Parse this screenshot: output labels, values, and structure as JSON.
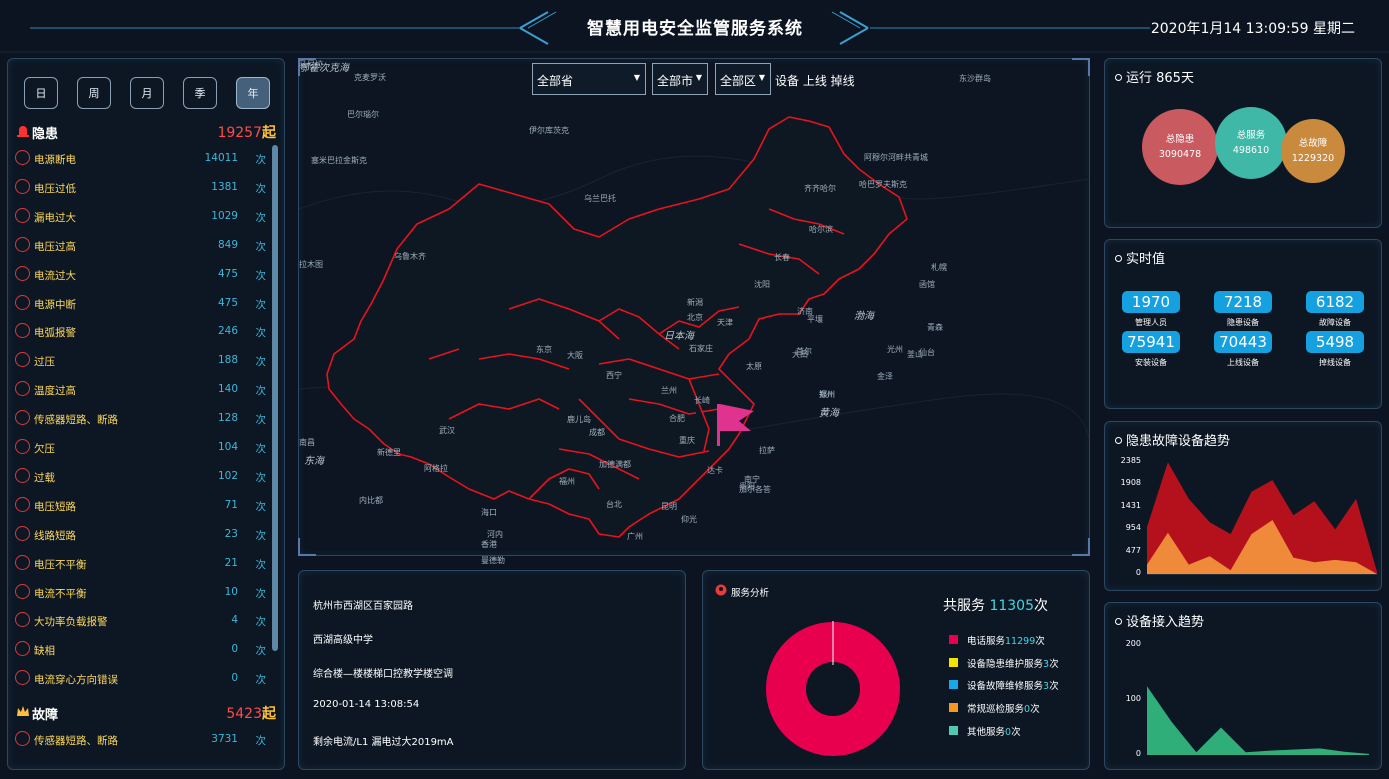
{
  "header": {
    "title": "智慧用电安全监管服务系统",
    "datetime": "2020年1月14 13:09:59 星期二"
  },
  "left": {
    "periods": [
      "日",
      "周",
      "月",
      "季",
      "年"
    ],
    "active_period": "年",
    "hazard": {
      "title": "隐患",
      "count": "19257",
      "unit": "起",
      "items": [
        {
          "label": "电源断电",
          "value": "14011",
          "unit": "次",
          "icon": "power-off-icon"
        },
        {
          "label": "电压过低",
          "value": "1381",
          "unit": "次",
          "icon": "voltage-low-icon"
        },
        {
          "label": "漏电过大",
          "value": "1029",
          "unit": "次",
          "icon": "warning-triangle-icon"
        },
        {
          "label": "电压过高",
          "value": "849",
          "unit": "次",
          "icon": "voltage-high-icon"
        },
        {
          "label": "电流过大",
          "value": "475",
          "unit": "次",
          "icon": "current-high-icon"
        },
        {
          "label": "电源中断",
          "value": "475",
          "unit": "次",
          "icon": "signal-off-icon"
        },
        {
          "label": "电弧报警",
          "value": "246",
          "unit": "次",
          "icon": "arc-alarm-icon"
        },
        {
          "label": "过压",
          "value": "188",
          "unit": "次",
          "icon": "overvoltage-icon"
        },
        {
          "label": "温度过高",
          "value": "140",
          "unit": "次",
          "icon": "thermometer-icon"
        },
        {
          "label": "传感器短路、断路",
          "value": "128",
          "unit": "次",
          "icon": "sensor-icon"
        },
        {
          "label": "欠压",
          "value": "104",
          "unit": "次",
          "icon": "undervoltage-icon"
        },
        {
          "label": "过载",
          "value": "102",
          "unit": "次",
          "icon": "overload-icon"
        },
        {
          "label": "电压短路",
          "value": "71",
          "unit": "次",
          "icon": "short-circuit-icon"
        },
        {
          "label": "线路短路",
          "value": "23",
          "unit": "次",
          "icon": "line-short-icon"
        },
        {
          "label": "电压不平衡",
          "value": "21",
          "unit": "次",
          "icon": "voltage-imbalance-icon"
        },
        {
          "label": "电流不平衡",
          "value": "10",
          "unit": "次",
          "icon": "current-imbalance-icon"
        },
        {
          "label": "大功率负载报警",
          "value": "4",
          "unit": "次",
          "icon": "high-load-icon"
        },
        {
          "label": "缺相",
          "value": "0",
          "unit": "次",
          "icon": "phase-loss-icon"
        },
        {
          "label": "电流穿心方向错误",
          "value": "0",
          "unit": "次",
          "icon": "direction-error-icon"
        }
      ]
    },
    "fault": {
      "title": "故障",
      "count": "5423",
      "unit": "起",
      "items": [
        {
          "label": "传感器短路、断路",
          "value": "3731",
          "unit": "次",
          "icon": "image-icon"
        }
      ]
    }
  },
  "map": {
    "selects": [
      {
        "value": "全部省"
      },
      {
        "value": "全部市"
      },
      {
        "value": "全部区"
      }
    ],
    "device_status": "设备 上线 掉线",
    "labels": [
      {
        "text": "克麦罗沃"
      },
      {
        "text": "巴尔瑙尔"
      },
      {
        "text": "伊尔库茨克"
      },
      {
        "text": "塞米巴拉金斯克"
      },
      {
        "text": "乌兰巴托"
      },
      {
        "text": "阿穆尔河畔共青城"
      },
      {
        "text": "哈巴罗夫斯克"
      },
      {
        "text": "齐齐哈尔"
      },
      {
        "text": "哈尔滨"
      },
      {
        "text": "长春"
      },
      {
        "text": "沈阳"
      },
      {
        "text": "乌鲁木齐"
      },
      {
        "text": "拉木图"
      },
      {
        "text": "札幌"
      },
      {
        "text": "函馆"
      },
      {
        "text": "青森"
      },
      {
        "text": "仙台"
      },
      {
        "text": "新潟"
      },
      {
        "text": "北京"
      },
      {
        "text": "天津"
      },
      {
        "text": "渤海"
      },
      {
        "text": "日本海"
      },
      {
        "text": "石家庄"
      },
      {
        "text": "济南"
      },
      {
        "text": "平壤"
      },
      {
        "text": "首尔"
      },
      {
        "text": "大田"
      },
      {
        "text": "光州"
      },
      {
        "text": "釜山"
      },
      {
        "text": "金泽"
      },
      {
        "text": "东京"
      },
      {
        "text": "大阪"
      },
      {
        "text": "西宁"
      },
      {
        "text": "兰州"
      },
      {
        "text": "银川"
      },
      {
        "text": "太原"
      },
      {
        "text": "郑州"
      },
      {
        "text": "黄海"
      },
      {
        "text": "长崎"
      },
      {
        "text": "鹿儿岛"
      },
      {
        "text": "合肥"
      },
      {
        "text": "成都"
      },
      {
        "text": "武汉"
      },
      {
        "text": "重庆"
      },
      {
        "text": "拉萨"
      },
      {
        "text": "南昌"
      },
      {
        "text": "东海"
      },
      {
        "text": "新德里"
      },
      {
        "text": "阿格拉"
      },
      {
        "text": "加德满都"
      },
      {
        "text": "达卡"
      },
      {
        "text": "贵阳"
      },
      {
        "text": "福州"
      },
      {
        "text": "台北"
      },
      {
        "text": "昆明"
      },
      {
        "text": "南宁"
      },
      {
        "text": "广州"
      },
      {
        "text": "香港"
      },
      {
        "text": "海口"
      },
      {
        "text": "河内"
      },
      {
        "text": "曼德勒"
      },
      {
        "text": "内比都"
      },
      {
        "text": "仰光"
      },
      {
        "text": "加尔各答"
      },
      {
        "text": "东沙群岛"
      },
      {
        "text": "马尼拉"
      },
      {
        "text": "鄂霍次克海"
      }
    ]
  },
  "info": {
    "lines": [
      "杭州市西湖区百家园路",
      "西湖高级中学",
      "综合楼—楼楼梯口控教学楼空调",
      "2020-01-14 13:08:54",
      "剩余电流/L1 漏电过大2019mA"
    ]
  },
  "service": {
    "title": "服务分析",
    "total_prefix": "共服务",
    "total": "11305",
    "total_unit": "次",
    "legend": [
      {
        "label": "电话服务",
        "count": "11299",
        "unit": "次",
        "color": "#e8004f"
      },
      {
        "label": "设备隐患维护服务",
        "count": "3",
        "unit": "次",
        "color": "#f5e400"
      },
      {
        "label": "设备故障维修服务",
        "count": "3",
        "unit": "次",
        "color": "#19a7e6"
      },
      {
        "label": "常规巡检服务",
        "count": "0",
        "unit": "次",
        "color": "#f39a1e"
      },
      {
        "label": "其他服务",
        "count": "0",
        "unit": "次",
        "color": "#4fc9b0"
      }
    ]
  },
  "run": {
    "title": "运行 865天",
    "bubbles": [
      {
        "label": "总隐患",
        "value": "3090478",
        "color": "#c95a60"
      },
      {
        "label": "总服务",
        "value": "498610",
        "color": "#3fb8a8"
      },
      {
        "label": "总故障",
        "value": "1229320",
        "color": "#c98a3e"
      }
    ]
  },
  "realtime": {
    "title": "实时值",
    "items": [
      {
        "value": "1970",
        "label": "管理人员"
      },
      {
        "value": "7218",
        "label": "隐患设备"
      },
      {
        "value": "6182",
        "label": "故障设备"
      },
      {
        "value": "75941",
        "label": "安装设备"
      },
      {
        "value": "70443",
        "label": "上线设备"
      },
      {
        "value": "5498",
        "label": "掉线设备"
      }
    ]
  },
  "chart_data": [
    {
      "type": "area",
      "title": "隐患故障设备趋势",
      "yticks": [
        "2385",
        "1908",
        "1431",
        "954",
        "477",
        "0"
      ],
      "ylim": [
        0,
        2385
      ],
      "x": [
        0,
        1,
        2,
        3,
        4,
        5,
        6,
        7,
        8,
        9,
        10,
        11
      ],
      "series": [
        {
          "values": [
            1000,
            2380,
            1600,
            1100,
            850,
            1750,
            2000,
            1250,
            1550,
            950,
            1600,
            50
          ],
          "color": "#b5111d"
        },
        {
          "values": [
            200,
            880,
            200,
            380,
            80,
            850,
            1150,
            350,
            250,
            300,
            250,
            0
          ],
          "color": "#ef8a3a"
        }
      ]
    },
    {
      "type": "area",
      "title": "设备接入趋势",
      "yticks": [
        "200",
        "100",
        "0"
      ],
      "ylim": [
        0,
        200
      ],
      "x": [
        0,
        1,
        2,
        3,
        4,
        5,
        6,
        7,
        8,
        9
      ],
      "series": [
        {
          "values": [
            125,
            60,
            5,
            50,
            5,
            8,
            10,
            12,
            6,
            2
          ],
          "color": "#2fae7a"
        }
      ]
    }
  ]
}
